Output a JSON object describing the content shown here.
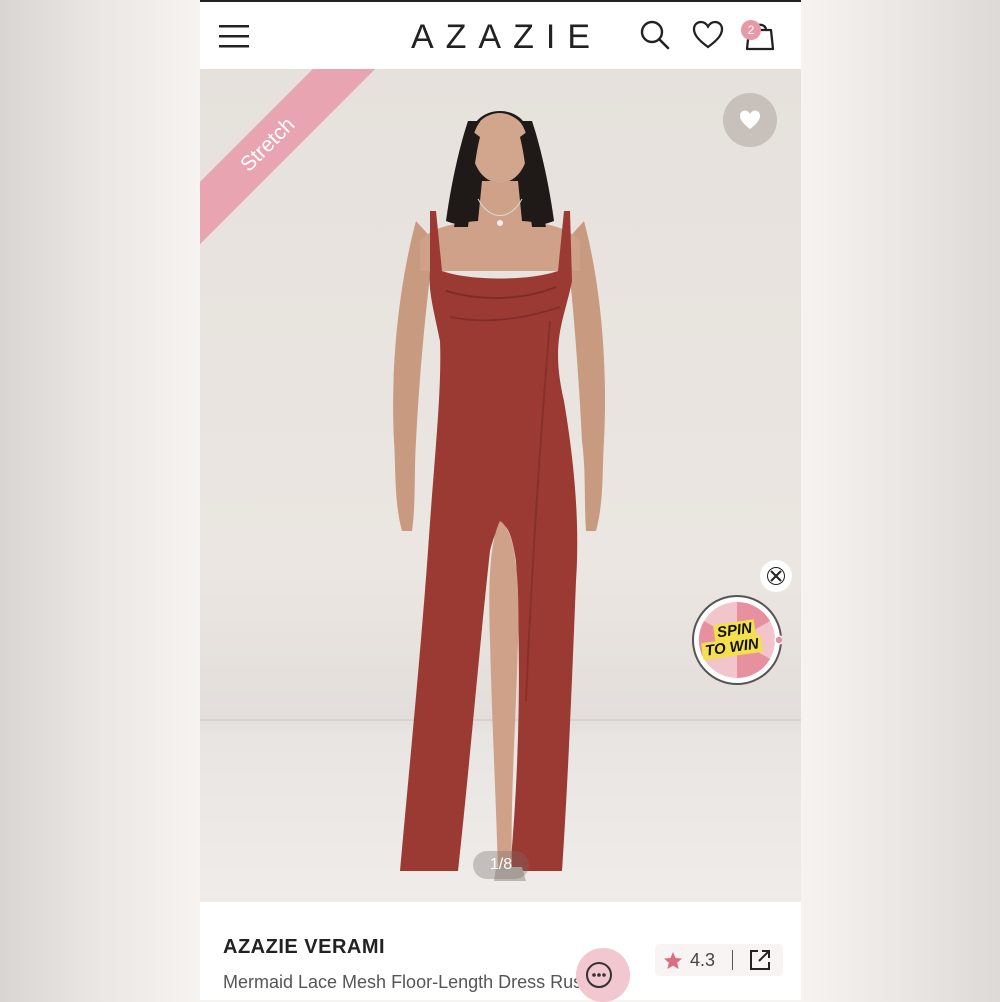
{
  "header": {
    "logo_text": "AZAZIE",
    "cart_count": "2"
  },
  "hero": {
    "badge_text": "Stretch",
    "image_counter": "1/8",
    "promo": {
      "line1": "SPIN",
      "line2": "TO WIN"
    }
  },
  "product": {
    "brand": "AZAZIE VERAMI",
    "description": "Mermaid Lace Mesh Floor-Length Dress Rust",
    "rating": "4.3"
  },
  "colors": {
    "accent_pink": "#e8a4b0",
    "dress_rust": "#9b3a33",
    "text_dark": "#222222"
  },
  "icons": [
    "menu-icon",
    "search-icon",
    "heart-icon",
    "bag-icon",
    "close-icon",
    "star-icon",
    "share-icon",
    "chat-icon"
  ]
}
